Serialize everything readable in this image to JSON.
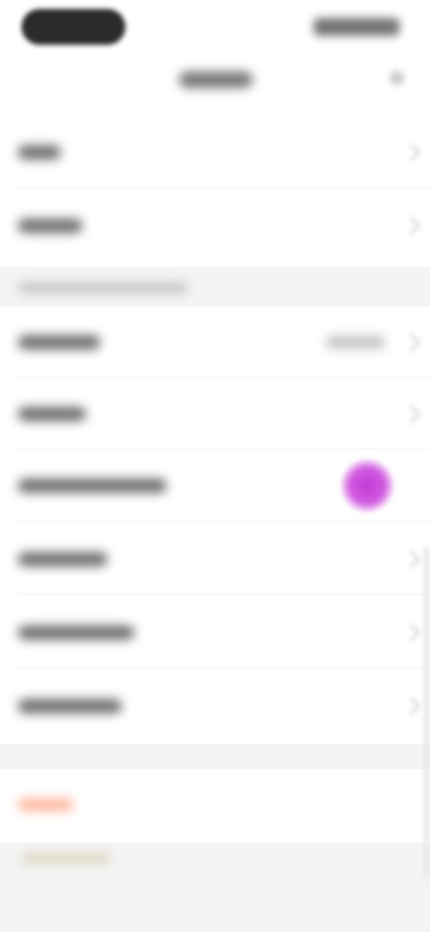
{
  "status_bar": {
    "time": "",
    "indicators": ""
  },
  "header": {
    "title": "",
    "action_icon": "settings-icon"
  },
  "rows_top": [
    {
      "label": ""
    },
    {
      "label": ""
    }
  ],
  "section": {
    "title": ""
  },
  "rows_main": [
    {
      "label": "",
      "value": ""
    },
    {
      "label": ""
    },
    {
      "label": "",
      "toggle": true
    },
    {
      "label": ""
    },
    {
      "label": ""
    },
    {
      "label": ""
    }
  ],
  "danger": {
    "label": ""
  },
  "footer": {
    "label": ""
  },
  "colors": {
    "toggle_accent": "#c23bd4",
    "danger": "#ff7a4a",
    "section_bg": "#f4f4f4"
  }
}
